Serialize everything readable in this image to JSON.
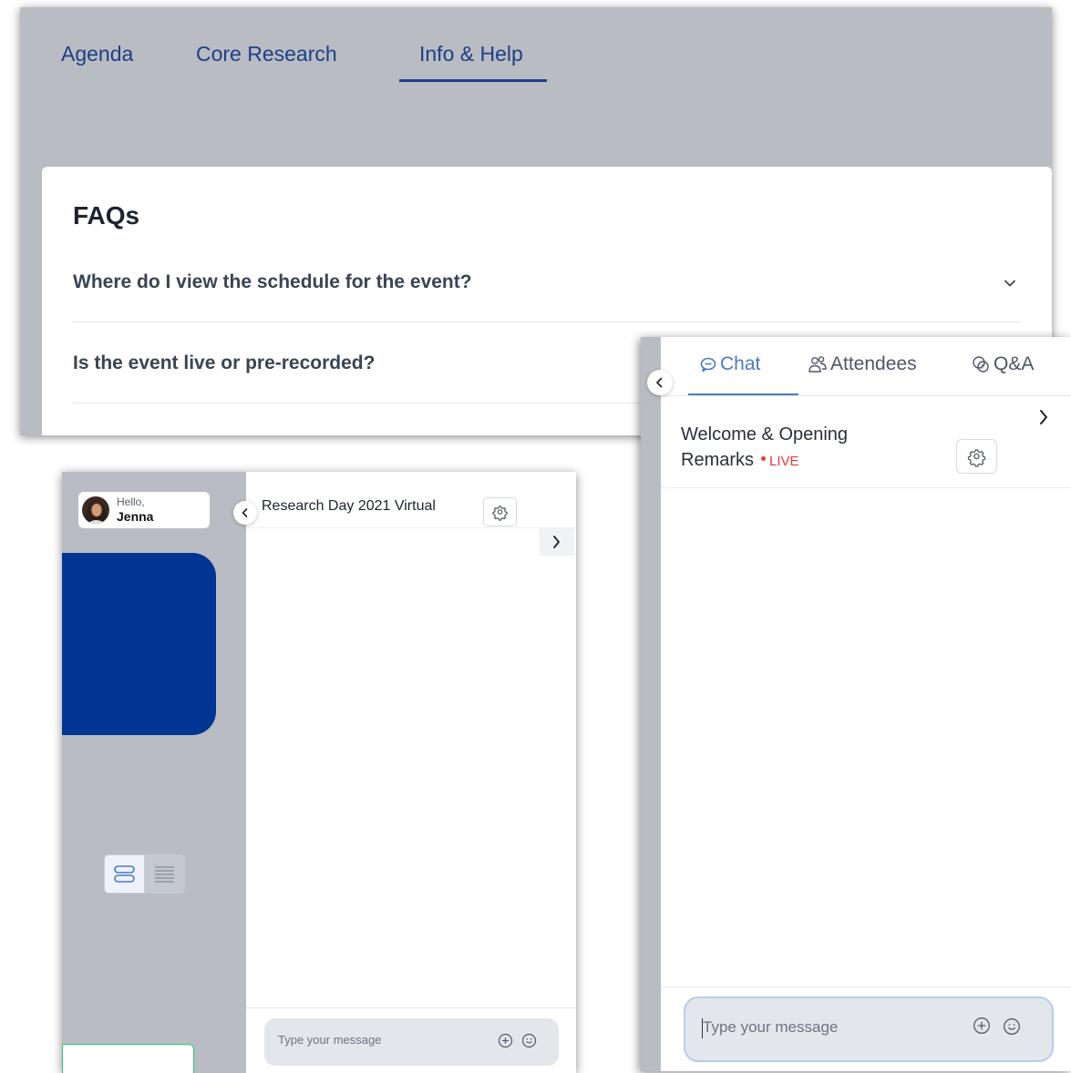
{
  "nav": {
    "tabs": [
      {
        "label": "Agenda"
      },
      {
        "label": "Core Research"
      },
      {
        "label": "Info & Help",
        "active": true
      }
    ]
  },
  "faq": {
    "title": "FAQs",
    "questions": [
      {
        "text": "Where do I view the schedule for the event?"
      },
      {
        "text": "Is the event live or pre-recorded?"
      }
    ]
  },
  "sidebar": {
    "greeting": "Hello,",
    "user_name": "Jenna"
  },
  "chat_small": {
    "session_title": "Research Day 2021 Virtual",
    "input_placeholder": "Type your message"
  },
  "chat_panel": {
    "tabs": [
      {
        "label": "Chat",
        "icon": "chat-bubble-icon",
        "active": true
      },
      {
        "label": "Attendees",
        "icon": "people-icon"
      },
      {
        "label": "Q&A",
        "icon": "qa-bubbles-icon"
      }
    ],
    "session_title_line1": "Welcome & Opening",
    "session_title_line2": "Remarks",
    "live_label": "LIVE",
    "input_placeholder": "Type your message"
  },
  "colors": {
    "accent": "#1e3f86",
    "brand_blue": "#003594",
    "live_red": "#e53935",
    "tab_active": "#4a7bc4",
    "backdrop": "#b9bcc2"
  }
}
